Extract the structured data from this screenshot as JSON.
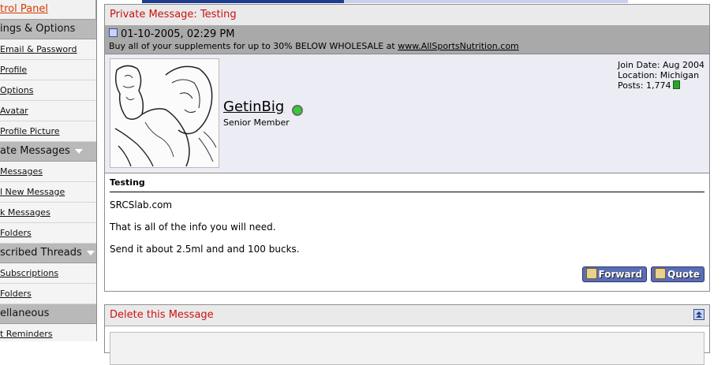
{
  "sidebar": {
    "control_panel": "trol Panel",
    "sections": [
      {
        "title": "ings & Options",
        "items": [
          "Email & Password",
          "Profile",
          "Options",
          "Avatar",
          "Profile Picture"
        ]
      },
      {
        "title": "ate Messages",
        "items": [
          "Messages",
          "l New Message",
          "k Messages",
          "Folders"
        ]
      },
      {
        "title": "scribed Threads",
        "items": [
          "Subscriptions",
          "Folders"
        ]
      },
      {
        "title": "ellaneous",
        "items": [
          "t Reminders"
        ]
      }
    ]
  },
  "message": {
    "panel_title": "Private Message: Testing",
    "date": "01-10-2005, 02:29 PM",
    "promo_prefix": "Buy all of your supplements for up to 30% BELOW WHOLESALE at ",
    "promo_link": "www.AllSportsNutrition.com",
    "username": "GetinBig",
    "user_title": "Senior Member",
    "join_date": "Join Date: Aug 2004",
    "location": "Location: Michigan",
    "posts": "Posts: 1,774",
    "title": "Testing",
    "lines": [
      "SRCSlab.com",
      "That is all of the info you will need.",
      "Send it about 2.5ml and and 100 bucks."
    ],
    "forward_label": "Forward",
    "quote_label": "Quote"
  },
  "delete_panel": {
    "title": "Delete this Message"
  },
  "colors": {
    "accent_red": "#cc1111",
    "header_gray": "#a9a9a9",
    "button_blue": "#5a6db5"
  },
  "icons": [
    "post-icon",
    "online-status-icon",
    "reputation-icon",
    "forward-icon",
    "quote-icon",
    "collapse-icon",
    "dropdown-arrow-icon"
  ]
}
